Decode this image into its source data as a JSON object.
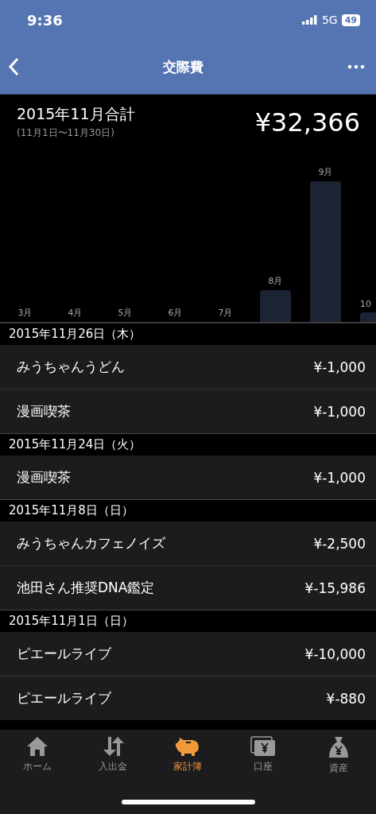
{
  "status_bar": {
    "time": "9:36",
    "network": "5G",
    "battery": "49"
  },
  "nav": {
    "title": "交際費"
  },
  "summary": {
    "title": "2015年11月合計",
    "period": "(11月1日〜11月30日)",
    "total": "¥32,366"
  },
  "months": [
    "3月",
    "4月",
    "5月",
    "6月",
    "7月",
    "8月",
    "9月",
    "10"
  ],
  "sections": [
    {
      "date": "2015年11月26日（木）",
      "items": [
        {
          "name": "みうちゃんうどん",
          "amount": "¥-1,000"
        },
        {
          "name": "漫画喫茶",
          "amount": "¥-1,000"
        }
      ]
    },
    {
      "date": "2015年11月24日（火）",
      "items": [
        {
          "name": "漫画喫茶",
          "amount": "¥-1,000"
        }
      ]
    },
    {
      "date": "2015年11月8日（日）",
      "items": [
        {
          "name": "みうちゃんカフェノイズ",
          "amount": "¥-2,500"
        },
        {
          "name": "池田さん推奨DNA鑑定",
          "amount": "¥-15,986"
        }
      ]
    },
    {
      "date": "2015年11月1日（日）",
      "items": [
        {
          "name": "ピエールライブ",
          "amount": "¥-10,000"
        },
        {
          "name": "ピエールライブ",
          "amount": "¥-880"
        }
      ]
    }
  ],
  "tabs": [
    {
      "kind": "home",
      "label": "ホーム",
      "selected": false
    },
    {
      "kind": "transfer",
      "label": "入出金",
      "selected": false
    },
    {
      "kind": "piggy",
      "label": "家計簿",
      "selected": true
    },
    {
      "kind": "account",
      "label": "口座",
      "selected": false
    },
    {
      "kind": "bag",
      "label": "資産",
      "selected": false
    }
  ]
}
